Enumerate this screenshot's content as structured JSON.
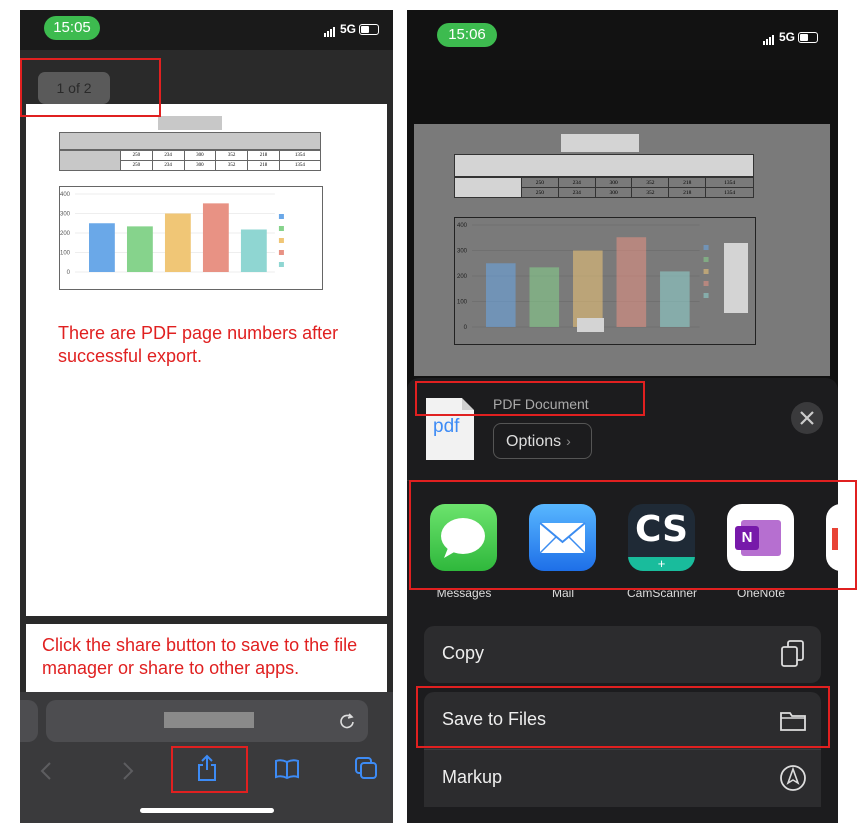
{
  "left_phone": {
    "status": {
      "time": "15:05",
      "network": "5G"
    },
    "page_counter": "1 of 2",
    "doc_table_values": [
      "250",
      "234",
      "300",
      "352",
      "218",
      "1354"
    ],
    "chart_y_ticks": [
      "400",
      "300",
      "200",
      "100",
      "0"
    ],
    "annotation_top": "There are PDF page numbers after successful export.",
    "annotation_bottom": "Click the share button to save to the file manager or share to other apps.",
    "toolbar_icons": [
      "back-icon",
      "forward-icon",
      "share-icon",
      "bookmarks-icon",
      "tabs-icon"
    ]
  },
  "right_phone": {
    "status": {
      "time": "15:06",
      "network": "5G"
    },
    "doc_table_values": [
      "250",
      "234",
      "300",
      "352",
      "218",
      "1354"
    ],
    "chart_y_ticks": [
      "400",
      "300",
      "200",
      "100",
      "0"
    ],
    "share_sheet": {
      "doc_type": "PDF Document",
      "doc_icon_text": "pdf",
      "options_label": "Options",
      "apps": [
        {
          "name": "Messages"
        },
        {
          "name": "Mail"
        },
        {
          "name": "CamScanner",
          "icon_text": "CS"
        },
        {
          "name": "OneNote",
          "icon_text": "N"
        }
      ],
      "actions": [
        {
          "label": "Copy",
          "icon": "copy-icon"
        },
        {
          "label": "Save to Files",
          "icon": "folder-icon"
        },
        {
          "label": "Markup",
          "icon": "markup-icon"
        }
      ]
    }
  },
  "chart_data": {
    "type": "bar",
    "categories": [
      "1",
      "2",
      "3",
      "4",
      "5"
    ],
    "values": [
      250,
      234,
      300,
      352,
      218
    ],
    "ylim": [
      0,
      400
    ],
    "colors": [
      "#6aa8e8",
      "#86d38c",
      "#f0c676",
      "#e89284",
      "#8fd6d2"
    ],
    "legend_colors": [
      "#6aa8e8",
      "#86d38c",
      "#f0c676",
      "#e89284",
      "#8fd6d2"
    ]
  }
}
